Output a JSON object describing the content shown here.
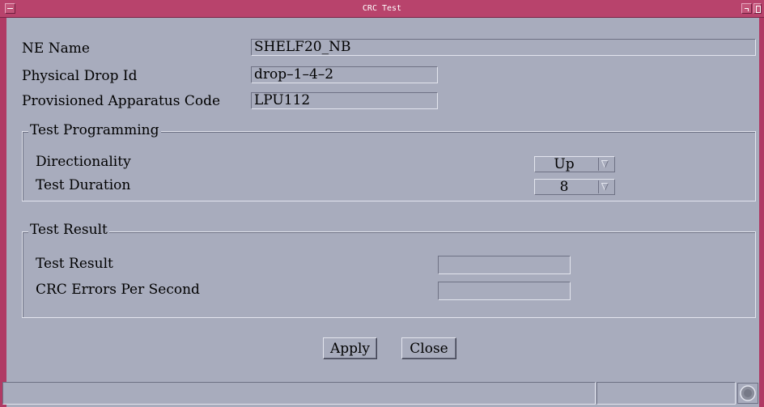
{
  "window": {
    "title": "CRC Test"
  },
  "fields": {
    "ne_name": {
      "label": "NE Name",
      "value": "SHELF20_NB"
    },
    "physical_drop_id": {
      "label": "Physical Drop Id",
      "value": "drop–1–4–2"
    },
    "apparatus_code": {
      "label": "Provisioned Apparatus Code",
      "value": "LPU112"
    }
  },
  "test_programming": {
    "title": "Test Programming",
    "directionality": {
      "label": "Directionality",
      "value": "Up"
    },
    "duration": {
      "label": "Test Duration",
      "value": "8"
    }
  },
  "test_result": {
    "title": "Test Result",
    "result": {
      "label": "Test Result",
      "value": ""
    },
    "crc_errors": {
      "label": "CRC Errors Per Second",
      "value": ""
    }
  },
  "buttons": {
    "apply": "Apply",
    "close": "Close"
  },
  "status": {
    "left": "",
    "right": ""
  },
  "icons": [
    "window-menu-icon",
    "minimize-icon",
    "maximize-icon",
    "dropdown-arrow-icon",
    "status-indicator-icon"
  ]
}
